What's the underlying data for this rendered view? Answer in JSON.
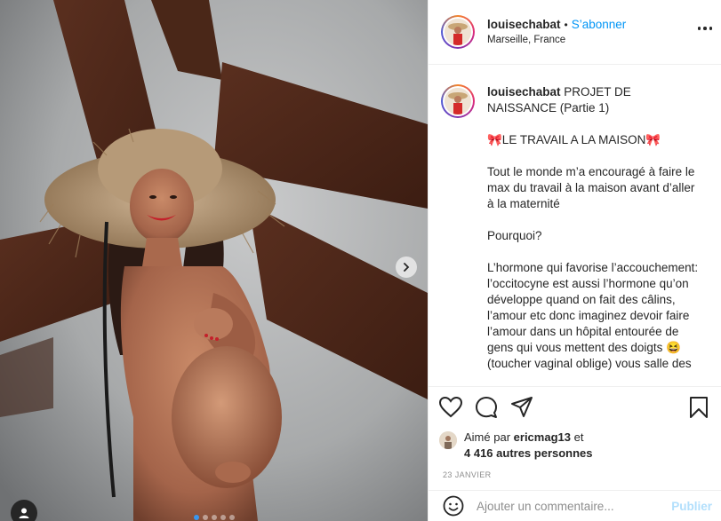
{
  "header": {
    "username": "louisechabat",
    "separator": "•",
    "follow_label": "S’abonner",
    "location": "Marseille, France"
  },
  "caption": {
    "username": "louisechabat",
    "paragraphs": [
      "PROJET DE NAISSANCE (Partie 1)",
      "🎀LE TRAVAIL A LA MAISON🎀",
      "Tout le monde m’a encouragé à faire le max du travail à la maison avant d’aller à la maternité",
      "Pourquoi?",
      "L’hormone qui favorise l’accouchement: l’occitocyne est aussi l’hormone qu’on développe quand on fait des câlins, l’amour etc donc imaginez devoir faire l’amour dans un hôpital entourée de gens qui vous mettent des doigts 😆 (toucher vaginal oblige) vous salle des"
    ]
  },
  "likes": {
    "prefix": "Aimé par",
    "first_user": "ericmag13",
    "conjunction": "et",
    "others": "4 416 autres personnes"
  },
  "date": "23 JANVIER",
  "comment": {
    "placeholder": "Ajouter un commentaire...",
    "publish_label": "Publier"
  },
  "icons": {
    "like": "heart-icon",
    "comment": "comment-bubble-icon",
    "share": "paper-plane-icon",
    "save": "bookmark-icon",
    "emoji": "smiley-icon",
    "next": "chevron-right-icon",
    "tag": "user-tag-icon",
    "options": "more-options-icon"
  },
  "carousel": {
    "slide_count": 5,
    "active_index": 0
  },
  "colors": {
    "follow_blue": "#0095f6",
    "publish_disabled": "#b2dffc",
    "active_dot": "#3897f0",
    "text": "#262626",
    "muted": "#8e8e8e"
  }
}
